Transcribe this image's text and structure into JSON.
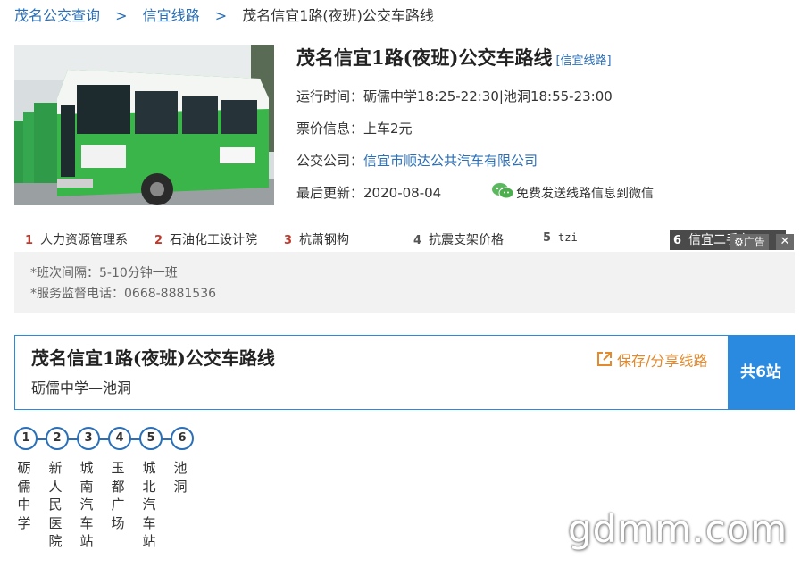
{
  "breadcrumb": {
    "home": "茂名公交查询",
    "sep1": ">",
    "category": "信宜线路",
    "sep2": ">",
    "current": "茂名信宜1路(夜班)公交车路线"
  },
  "info": {
    "title": "茂名信宜1路(夜班)公交车路线",
    "title_tag": "[信宜线路]",
    "time_label": "运行时间：",
    "time_value": "砺儒中学18:25-22:30|池洞18:55-23:00",
    "fare_label": "票价信息：",
    "fare_value": "上车2元",
    "company_label": "公交公司：",
    "company_value": "信宜市顺达公共汽车有限公司",
    "update_label": "最后更新：",
    "update_value": "2020-08-04",
    "wechat_text": "免费发送线路信息到微信",
    "wechat_icon": "wechat-icon"
  },
  "ads": [
    {
      "num": "1",
      "text": "人力资源管理系"
    },
    {
      "num": "2",
      "text": "石油化工设计院"
    },
    {
      "num": "3",
      "text": "杭萧钢构"
    },
    {
      "num": "4",
      "text": "抗震支架价格"
    },
    {
      "num": "5",
      "text": "tzi"
    },
    {
      "num": "6",
      "text": "信宜二手车"
    }
  ],
  "ad_label": "广告",
  "ad_close": "✕",
  "notes": {
    "interval": "*班次间隔：5-10分钟一班",
    "phone": "*服务监督电话：0668-8881536"
  },
  "route": {
    "title": "茂名信宜1路(夜班)公交车路线",
    "span": "砺儒中学—池洞",
    "share": "保存/分享线路",
    "share_icon": "share-icon",
    "count": "共6站",
    "accent": "#2a8ae0"
  },
  "stops": [
    {
      "num": "1",
      "name": "砺儒中学"
    },
    {
      "num": "2",
      "name": "新人民医院"
    },
    {
      "num": "3",
      "name": "城南汽车站"
    },
    {
      "num": "4",
      "name": "玉都广场"
    },
    {
      "num": "5",
      "name": "城北汽车站"
    },
    {
      "num": "6",
      "name": "池洞"
    }
  ],
  "watermark": "gdmm.com"
}
